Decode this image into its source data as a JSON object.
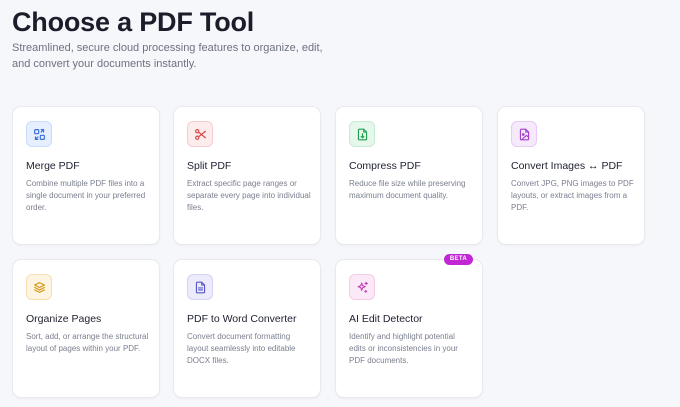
{
  "header": {
    "title": "Choose a PDF Tool",
    "subtitle": "Streamlined, secure cloud processing features to organize, edit, and convert your documents instantly."
  },
  "tools": [
    {
      "name": "Merge PDF",
      "description": "Combine multiple PDF files into a single document in your preferred order.",
      "icon": "merge-icon",
      "color": "#3b6fd8"
    },
    {
      "name": "Split PDF",
      "description": "Extract specific page ranges or separate every page into individual files.",
      "icon": "scissors-icon",
      "color": "#d64545"
    },
    {
      "name": "Compress PDF",
      "description": "Reduce file size while preserving maximum document quality.",
      "icon": "compress-file-icon",
      "color": "#22a052"
    },
    {
      "name": "Convert Images ↔ PDF",
      "description": "Convert JPG, PNG images to PDF layouts, or extract images from a PDF.",
      "icon": "image-file-icon",
      "color": "#a53fd0"
    },
    {
      "name": "Organize Pages",
      "description": "Sort, add, or arrange the structural layout of pages within your PDF.",
      "icon": "layers-icon",
      "color": "#d49a1e"
    },
    {
      "name": "PDF to Word Converter",
      "description": "Convert document formatting layout seamlessly into editable DOCX files.",
      "icon": "document-icon",
      "color": "#5a57c7"
    },
    {
      "name": "AI Edit Detector",
      "description": "Identify and highlight potential edits or inconsistencies in your PDF documents.",
      "icon": "sparkles-icon",
      "color": "#c23bb0",
      "badge": "BETA"
    }
  ]
}
